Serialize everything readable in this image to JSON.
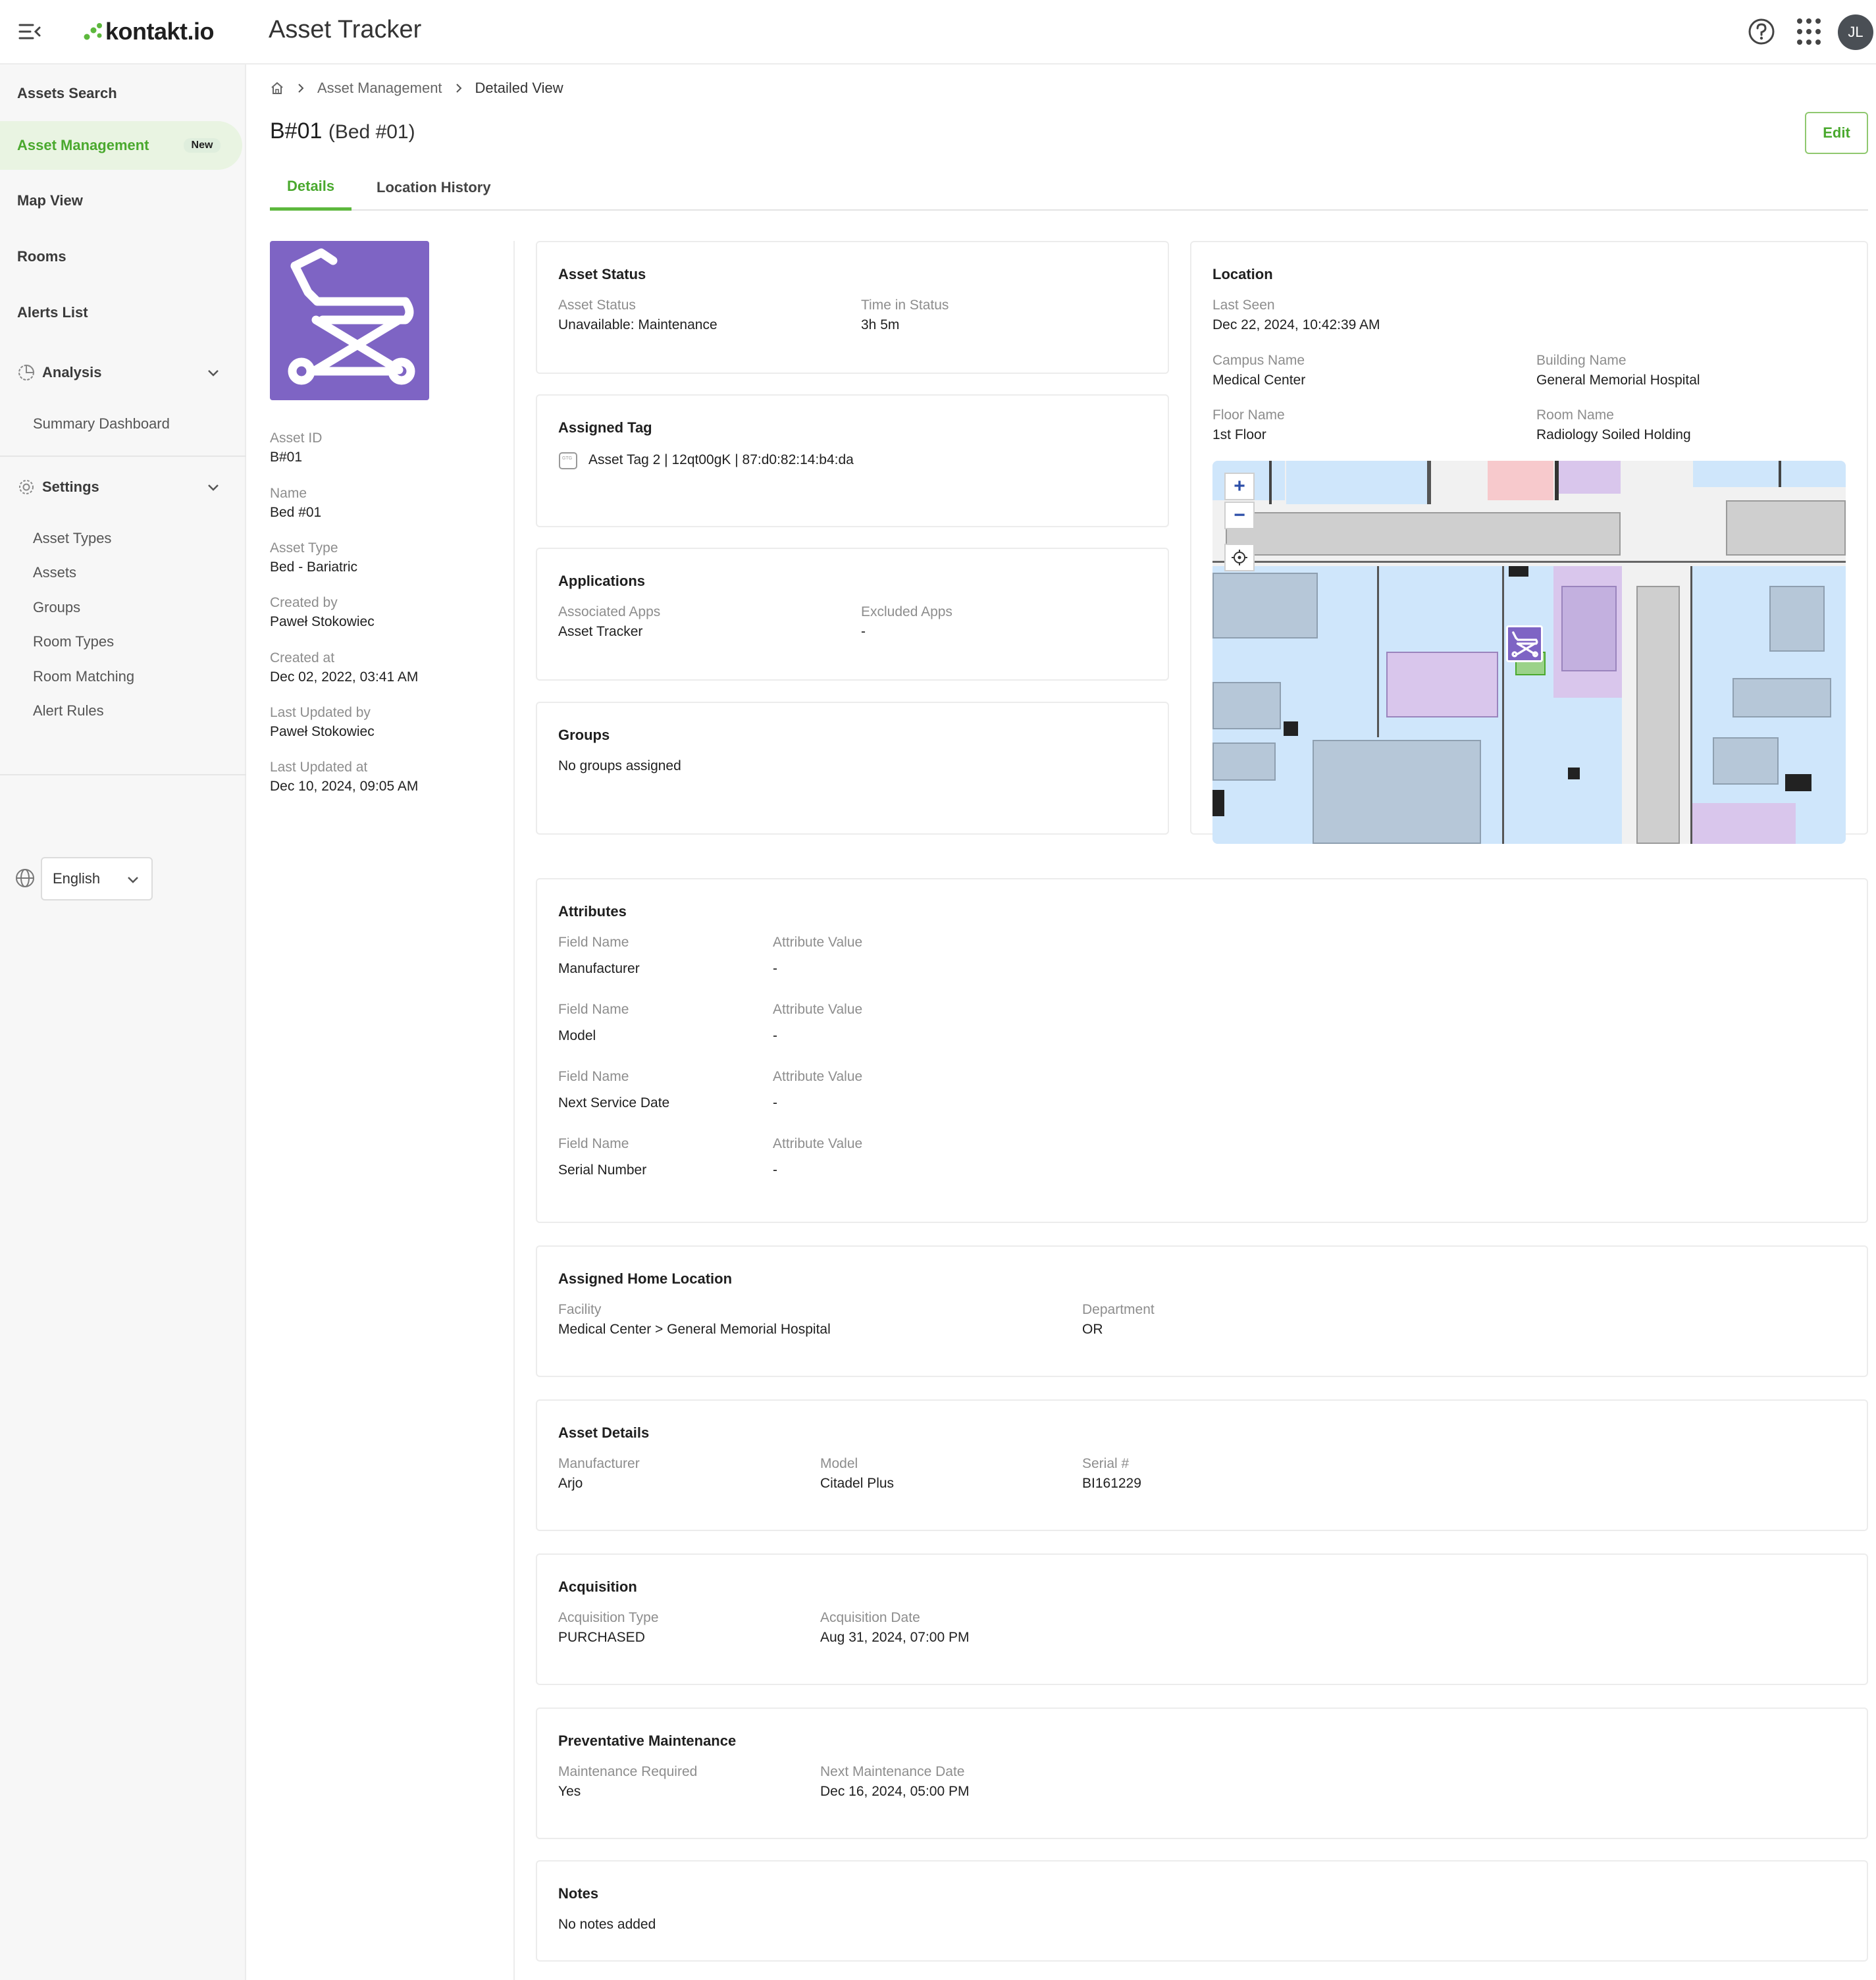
{
  "header": {
    "logo_text": "kontakt.io",
    "app_title": "Asset Tracker",
    "avatar_initials": "JL",
    "brand_color": "#4aa92e"
  },
  "sidebar": {
    "items": [
      {
        "label": "Assets Search"
      },
      {
        "label": "Asset Management",
        "badge": "New",
        "active": true
      },
      {
        "label": "Map View"
      },
      {
        "label": "Rooms"
      },
      {
        "label": "Alerts List"
      }
    ],
    "analysis": {
      "label": "Analysis",
      "children": [
        "Summary Dashboard"
      ]
    },
    "settings": {
      "label": "Settings",
      "children": [
        "Asset Types",
        "Assets",
        "Groups",
        "Room Types",
        "Room Matching",
        "Alert Rules"
      ]
    },
    "language": "English"
  },
  "breadcrumb": {
    "items": [
      "Asset Management",
      "Detailed View"
    ]
  },
  "page": {
    "title": "B#01",
    "subtitle": "(Bed #01)",
    "edit_label": "Edit",
    "tabs": [
      "Details",
      "Location History"
    ]
  },
  "asset_meta": [
    {
      "label": "Asset ID",
      "value": "B#01"
    },
    {
      "label": "Name",
      "value": "Bed #01"
    },
    {
      "label": "Asset Type",
      "value": "Bed - Bariatric"
    },
    {
      "label": "Created by",
      "value": "Paweł Stokowiec"
    },
    {
      "label": "Created at",
      "value": "Dec 02, 2022, 03:41 AM"
    },
    {
      "label": "Last Updated by",
      "value": "Paweł Stokowiec"
    },
    {
      "label": "Last Updated at",
      "value": "Dec 10, 2024, 09:05 AM"
    }
  ],
  "asset_status": {
    "title": "Asset Status",
    "status_label": "Asset Status",
    "status_value": "Unavailable: Maintenance",
    "time_label": "Time in Status",
    "time_value": "3h 5m"
  },
  "assigned_tag": {
    "title": "Assigned Tag",
    "value": "Asset Tag 2 | 12qt00gK | 87:d0:82:14:b4:da"
  },
  "applications": {
    "title": "Applications",
    "associated_label": "Associated Apps",
    "associated_value": "Asset Tracker",
    "excluded_label": "Excluded Apps",
    "excluded_value": "-"
  },
  "groups": {
    "title": "Groups",
    "value": "No groups assigned"
  },
  "location": {
    "title": "Location",
    "last_seen_label": "Last Seen",
    "last_seen_value": "Dec 22, 2024, 10:42:39 AM",
    "campus_label": "Campus Name",
    "campus_value": "Medical Center",
    "building_label": "Building Name",
    "building_value": "General Memorial Hospital",
    "floor_label": "Floor Name",
    "floor_value": "1st Floor",
    "room_label": "Room Name",
    "room_value": "Radiology Soiled Holding",
    "map_zoom_in": "+",
    "map_zoom_out": "−"
  },
  "attributes": {
    "title": "Attributes",
    "field_label": "Field Name",
    "value_label": "Attribute Value",
    "rows": [
      {
        "name": "Manufacturer",
        "value": "-"
      },
      {
        "name": "Model",
        "value": "-"
      },
      {
        "name": "Next Service Date",
        "value": "-"
      },
      {
        "name": "Serial Number",
        "value": "-"
      }
    ]
  },
  "home_location": {
    "title": "Assigned Home Location",
    "facility_label": "Facility",
    "facility_value": "Medical Center > General Memorial Hospital",
    "department_label": "Department",
    "department_value": "OR"
  },
  "asset_details": {
    "title": "Asset Details",
    "manufacturer_label": "Manufacturer",
    "manufacturer_value": "Arjo",
    "model_label": "Model",
    "model_value": "Citadel Plus",
    "serial_label": "Serial #",
    "serial_value": "BI161229"
  },
  "acquisition": {
    "title": "Acquisition",
    "type_label": "Acquisition Type",
    "type_value": "PURCHASED",
    "date_label": "Acquisition Date",
    "date_value": "Aug 31, 2024, 07:00 PM"
  },
  "maintenance": {
    "title": "Preventative Maintenance",
    "required_label": "Maintenance Required",
    "required_value": "Yes",
    "next_label": "Next Maintenance Date",
    "next_value": "Dec 16, 2024, 05:00 PM"
  },
  "notes": {
    "title": "Notes",
    "value": "No notes added"
  }
}
